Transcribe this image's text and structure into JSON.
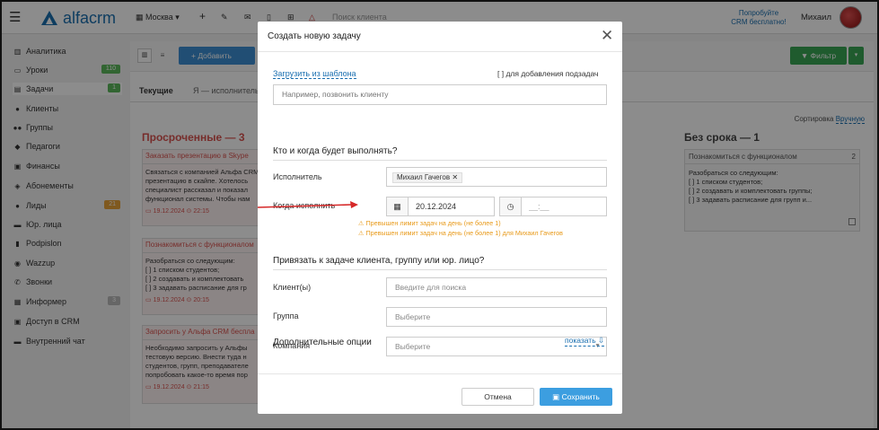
{
  "topbar": {
    "logo_text": "alfacrm",
    "branch": "Москва",
    "search_placeholder": "Поиск клиента",
    "promo_line1": "Попробуйте",
    "promo_line2": "CRM бесплатно!",
    "user_name": "Михаил"
  },
  "sidebar": {
    "items": [
      {
        "label": "Аналитика",
        "icon": "chart-icon",
        "badge": ""
      },
      {
        "label": "Уроки",
        "icon": "calendar-icon",
        "badge": "110"
      },
      {
        "label": "Задачи",
        "icon": "tasks-icon",
        "badge": "1"
      },
      {
        "label": "Клиенты",
        "icon": "user-icon",
        "badge": ""
      },
      {
        "label": "Группы",
        "icon": "users-icon",
        "badge": ""
      },
      {
        "label": "Педагоги",
        "icon": "graduation-cap-icon",
        "badge": ""
      },
      {
        "label": "Финансы",
        "icon": "money-icon",
        "badge": ""
      },
      {
        "label": "Абонементы",
        "icon": "tag-icon",
        "badge": ""
      },
      {
        "label": "Лиды",
        "icon": "lead-icon",
        "badge": "21"
      },
      {
        "label": "Юр. лица",
        "icon": "briefcase-icon",
        "badge": ""
      },
      {
        "label": "Podpislon",
        "icon": "document-icon",
        "badge": ""
      },
      {
        "label": "Wazzup",
        "icon": "whatsapp-icon",
        "badge": ""
      },
      {
        "label": "Звонки",
        "icon": "phone-icon",
        "badge": ""
      },
      {
        "label": "Информер",
        "icon": "informer-icon",
        "badge": "3"
      },
      {
        "label": "Доступ в CRM",
        "icon": "lock-icon",
        "badge": ""
      },
      {
        "label": "Внутренний чат",
        "icon": "chat-icon",
        "badge": ""
      }
    ]
  },
  "main": {
    "add_label": "+ Добавить",
    "filter_label": "Фильтр",
    "tabs": [
      "Текущие",
      "Я — исполнитель"
    ],
    "sort_label": "Сортировка",
    "sort_value": "Вручную",
    "overdue_title": "Просроченные — 3",
    "nodue_title": "Без срока — 1",
    "overdue_cards": [
      {
        "title": "Заказать презентацию в Skype",
        "lines": [
          "Связаться с компанией Альфа CRM",
          "презентацию в скайпе. Хотелось",
          "специалист рассказал и показал",
          "функционал системы. Чтобы нам"
        ],
        "date": "19.12.2024 ⊙ 22:15"
      },
      {
        "title": "Познакомиться с функционалом",
        "lines": [
          "Разобраться со следующим:",
          "[ ] 1 списком студентов;",
          "[ ] 2 создавать и комплектовать",
          "[ ] 3 задавать расписание для гр"
        ],
        "date": "19.12.2024 ⊙ 20:15"
      },
      {
        "title": "Запросить у Альфа CRM беспла",
        "lines": [
          "Необходимо запросить у Альфы",
          "тестовую версию. Внести туда н",
          "студентов, групп, преподавателе",
          "попробовать какое-то время пор"
        ],
        "date": "19.12.2024 ⊙ 21:15"
      }
    ],
    "nodue_card": {
      "title": "Познакомиться с функционалом",
      "count": "2",
      "lines": [
        "Разобраться со следующим:",
        "[ ] 1 списком студентов;",
        "[ ] 2 создавать и комплектовать группы;",
        "[ ] 3 задавать расписание для групп и..."
      ]
    }
  },
  "modal": {
    "title": "Создать новую задачу",
    "template_link": "Загрузить из шаблона",
    "subtask_label": "[ ] для добавления подзадач",
    "task_placeholder": "Например, позвонить клиенту",
    "section_who": "Кто и когда будет выполнять?",
    "executor_label": "Исполнитель",
    "executor_value": "Михаил Гачегов",
    "when_label": "Когда исполнить",
    "date_value": "20.12.2024",
    "time_value": "__:__",
    "warning1": "⚠ Превышен лимит задач на день (не более 1)",
    "warning2": "⚠ Превышен лимит задач на день (не более 1) для Михаил Гачегов",
    "section_link": "Привязать к задаче клиента, группу или юр. лицо?",
    "clients_label": "Клиент(ы)",
    "clients_placeholder": "Введите для поиска",
    "group_label": "Группа",
    "group_placeholder": "Выберите",
    "company_label": "Компания",
    "company_placeholder": "Выберите",
    "extra_title": "Дополнительные опции",
    "show_link": "показать ⇩",
    "cancel_label": "Отмена",
    "save_label": "Сохранить"
  },
  "colors": {
    "accent": "#3c8fd3",
    "danger": "#d9534f",
    "warning": "#e89a1a",
    "success": "#3aa655"
  }
}
